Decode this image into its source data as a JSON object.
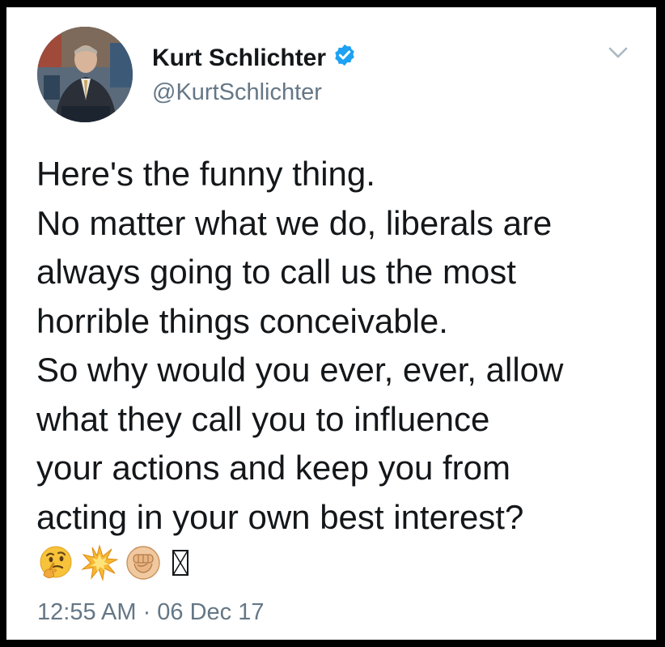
{
  "author": {
    "display_name": "Kurt Schlichter",
    "handle": "@KurtSchlichter",
    "verified": true,
    "verified_color": "#1da1f2"
  },
  "tweet": {
    "lines": [
      "Here's the funny thing.",
      "No matter what we do, liberals are",
      "always going to call us the most",
      "horrible things conceivable.",
      "So why would you ever, ever, allow",
      "what they call you to influence",
      "your actions and keep you from",
      "acting in your own best interest?"
    ],
    "emojis": [
      "thinking-face-icon",
      "collision-icon",
      "raised-fist-icon",
      "missing-glyph-box-icon"
    ],
    "missing_glyph": "▯"
  },
  "meta": {
    "timestamp": "12:55 AM · 06 Dec 17"
  },
  "colors": {
    "text_primary": "#14171a",
    "text_secondary": "#657786",
    "frame": "#000000"
  }
}
